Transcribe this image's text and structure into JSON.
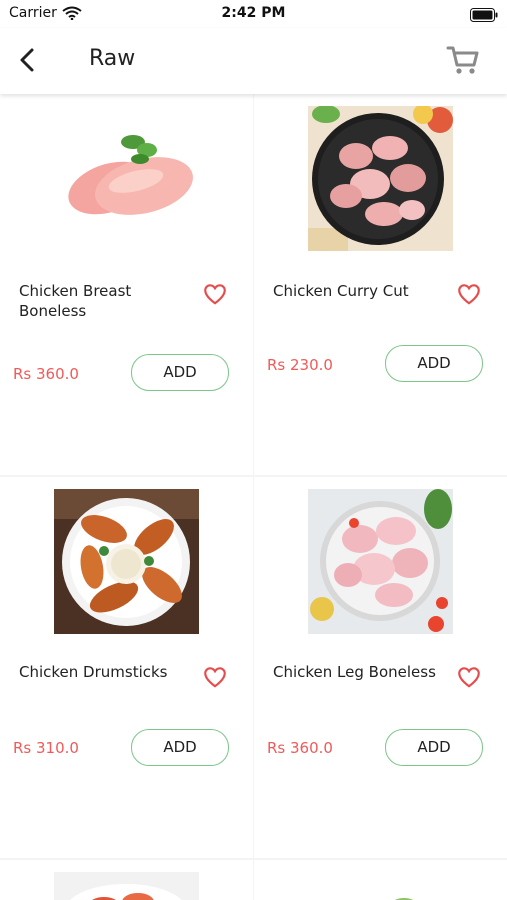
{
  "status_bar": {
    "carrier": "Carrier",
    "time": "2:42 PM"
  },
  "header": {
    "title": "Raw"
  },
  "colors": {
    "price": "#f15a5a",
    "add_border": "#7cc68a",
    "heart": "#e74c4c"
  },
  "products": [
    {
      "name": "Chicken Breast Boneless",
      "price": "Rs 360.0",
      "button": "ADD"
    },
    {
      "name": "Chicken Curry Cut",
      "price": "Rs 230.0",
      "button": "ADD"
    },
    {
      "name": "Chicken Drumsticks",
      "price": "Rs 310.0",
      "button": "ADD"
    },
    {
      "name": "Chicken Leg Boneless",
      "price": "Rs 360.0",
      "button": "ADD"
    }
  ]
}
